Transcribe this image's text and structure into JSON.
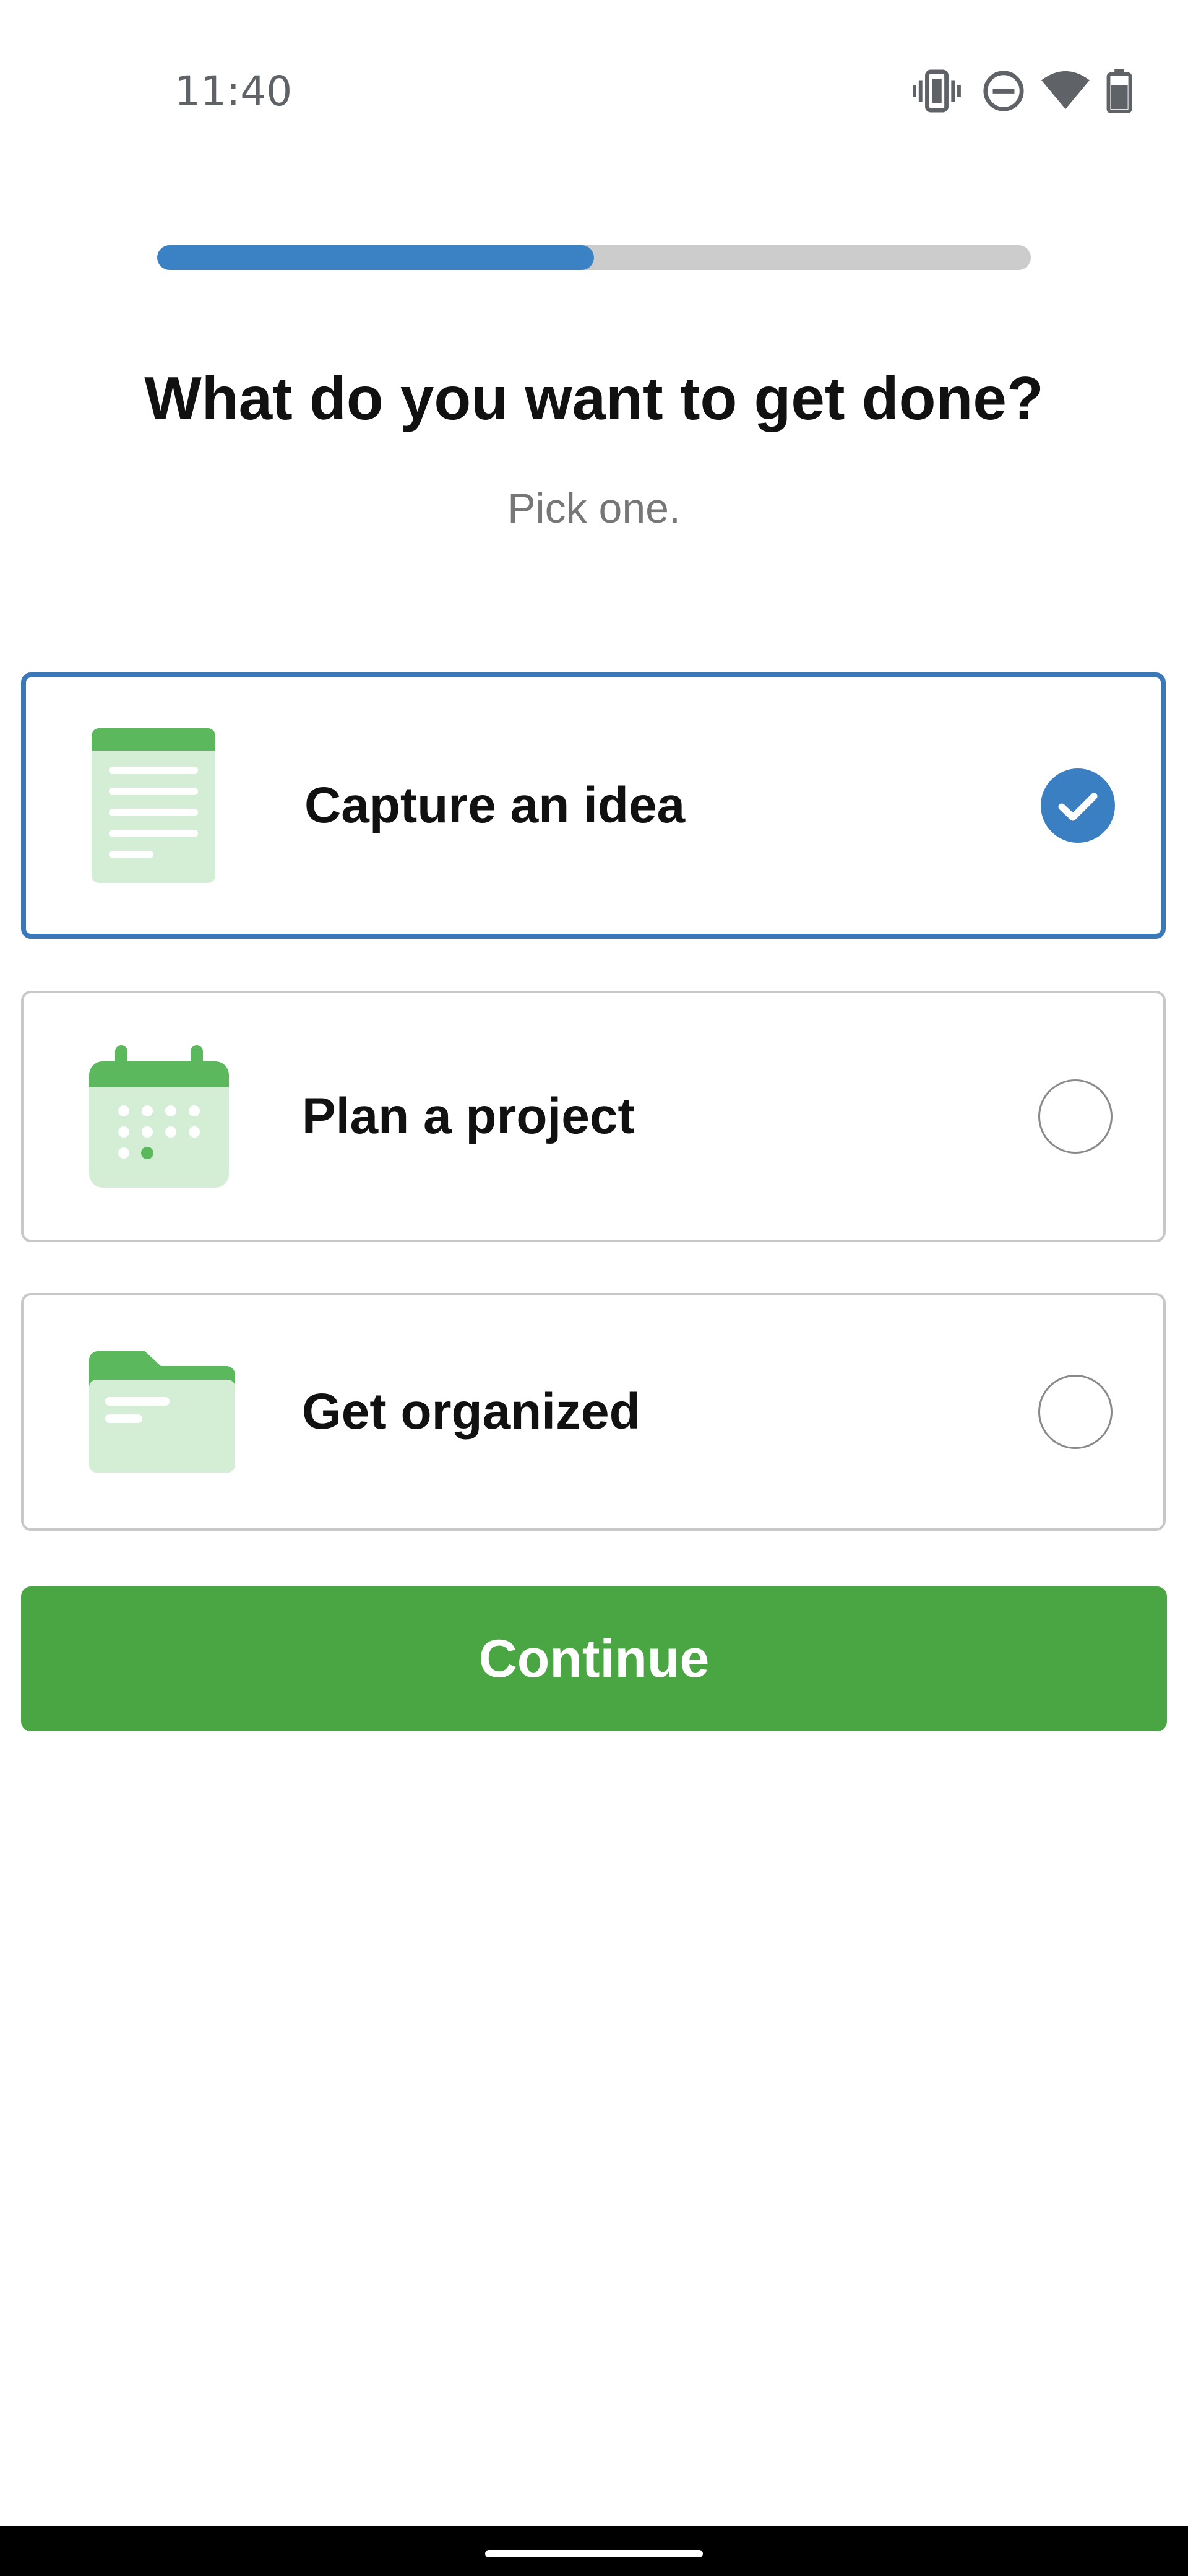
{
  "status_bar": {
    "time": "11:40",
    "icons": [
      "vibrate-icon",
      "do-not-disturb-icon",
      "wifi-icon",
      "battery-icon"
    ]
  },
  "progress": {
    "fraction": 0.5,
    "color": "#3a82c4",
    "track_color": "#cccccc"
  },
  "header": {
    "title": "What do you want to get done?",
    "subtitle": "Pick one."
  },
  "options": [
    {
      "label": "Capture an idea",
      "icon": "document-icon",
      "selected": true
    },
    {
      "label": "Plan a project",
      "icon": "calendar-icon",
      "selected": false
    },
    {
      "label": "Get organized",
      "icon": "folder-icon",
      "selected": false
    }
  ],
  "continue_button": {
    "label": "Continue",
    "color": "#4aa642"
  },
  "colors": {
    "accent_blue": "#3a78b8",
    "brand_green": "#4aa642",
    "icon_green": "#5cb85c",
    "icon_green_light": "#d4eed6"
  }
}
